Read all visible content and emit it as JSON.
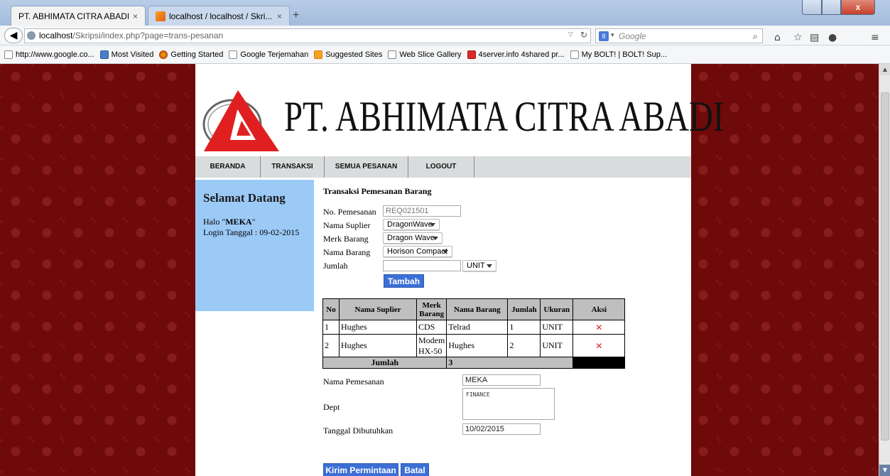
{
  "browser": {
    "tabs": [
      {
        "title": "PT. ABHIMATA CITRA ABADI",
        "close": "×"
      },
      {
        "title": "localhost / localhost / Skri...",
        "close": "×"
      }
    ],
    "new_tab": "+",
    "window_close": "x",
    "url_host": "localhost",
    "url_path": "/Skripsi/index.php?page=trans-pesanan",
    "search_engine": "8",
    "search_placeholder": "Google",
    "bookmarks": [
      "http://www.google.co...",
      "Most Visited",
      "Getting Started",
      "Google Terjemahan",
      "Suggested Sites",
      "Web Slice Gallery",
      "4server.info 4shared pr...",
      "My BOLT! | BOLT! Sup..."
    ]
  },
  "header": {
    "company": "PT. ABHIMATA CITRA ABADI"
  },
  "menu": [
    {
      "label": "BERANDA"
    },
    {
      "label": "TRANSAKSI"
    },
    {
      "label": "SEMUA PESANAN"
    },
    {
      "label": "LOGOUT"
    }
  ],
  "sidebar": {
    "welcome": "Selamat Datang",
    "hello_prefix": "Halo \"",
    "user": "MEKA",
    "hello_suffix": "\"",
    "login_date": "Login Tanggal : 09-02-2015"
  },
  "form": {
    "title": "Transaksi Pemesanan Barang",
    "labels": {
      "no": "No. Pemesanan",
      "supplier": "Nama Suplier",
      "merk": "Merk Barang",
      "barang": "Nama Barang",
      "jumlah": "Jumlah"
    },
    "no_value": "REQ021501",
    "supplier_value": "DragonWave",
    "merk_value": "Dragon Wave",
    "barang_value": "Horison Compact",
    "jumlah_value": "",
    "unit_value": "UNIT",
    "add_button": "Tambah"
  },
  "table": {
    "headers": [
      "No",
      "Nama Suplier",
      "Merk Barang",
      "Nama Barang",
      "Jumlah",
      "Ukuran",
      "Aksi"
    ],
    "rows": [
      {
        "no": "1",
        "supplier": "Hughes",
        "merk": "CDS",
        "barang": "Telrad",
        "jumlah": "1",
        "ukuran": "UNIT"
      },
      {
        "no": "2",
        "supplier": "Hughes",
        "merk": "Modem HX-50",
        "barang": "Hughes",
        "jumlah": "2",
        "ukuran": "UNIT"
      }
    ],
    "delete_icon": "✕",
    "sum_label": "Jumlah",
    "sum_value": "3"
  },
  "footer_form": {
    "pemesan_label": "Nama Pemesanan",
    "pemesan_value": "MEKA",
    "dept_label": "Dept",
    "dept_value": "FINANCE",
    "tanggal_label": "Tanggal Dibutuhkan",
    "tanggal_value": "10/02/2015",
    "submit_button": "Kirim Permintaan",
    "cancel_button": "Batal"
  }
}
